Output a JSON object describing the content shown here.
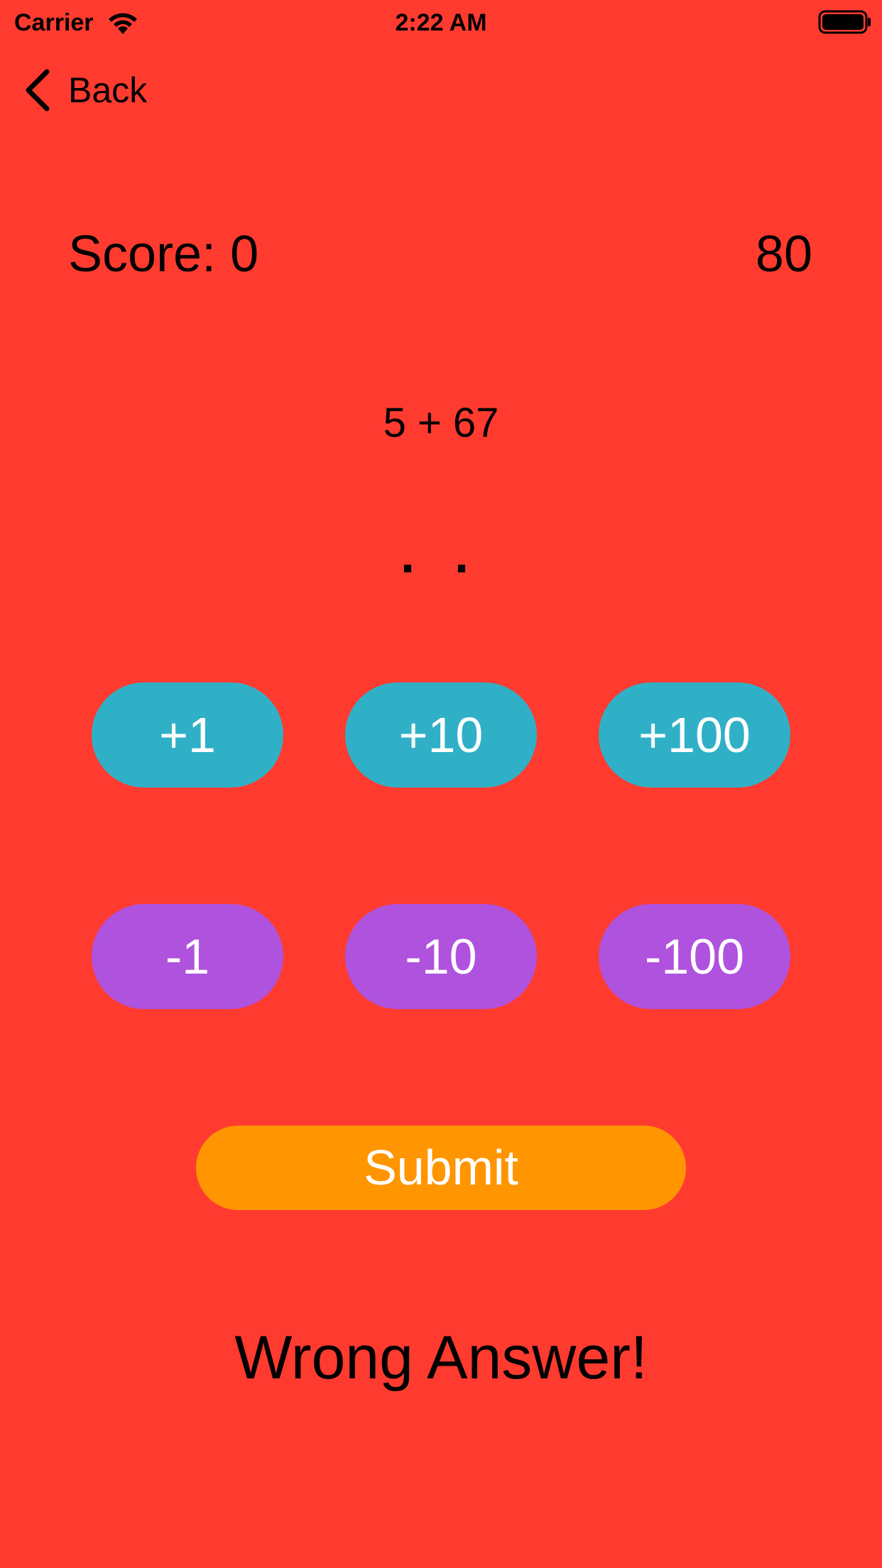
{
  "status_bar": {
    "carrier": "Carrier",
    "time": "2:22 AM",
    "wifi_icon": "wifi-icon",
    "battery_icon": "battery-icon"
  },
  "nav": {
    "back_label": "Back",
    "back_icon": "chevron-left-icon"
  },
  "game": {
    "score_label": "Score: 0",
    "timer": "80",
    "problem": "5 + 67",
    "answer": ". ."
  },
  "controls": {
    "plus": [
      {
        "label": "+1"
      },
      {
        "label": "+10"
      },
      {
        "label": "+100"
      }
    ],
    "minus": [
      {
        "label": "-1"
      },
      {
        "label": "-10"
      },
      {
        "label": "-100"
      }
    ],
    "submit_label": "Submit"
  },
  "result": {
    "message": "Wrong Answer!"
  },
  "colors": {
    "background": "#ff3b30",
    "plus_button": "#30b0c7",
    "minus_button": "#af52de",
    "submit_button": "#ff9500",
    "button_text": "#ffffff"
  }
}
